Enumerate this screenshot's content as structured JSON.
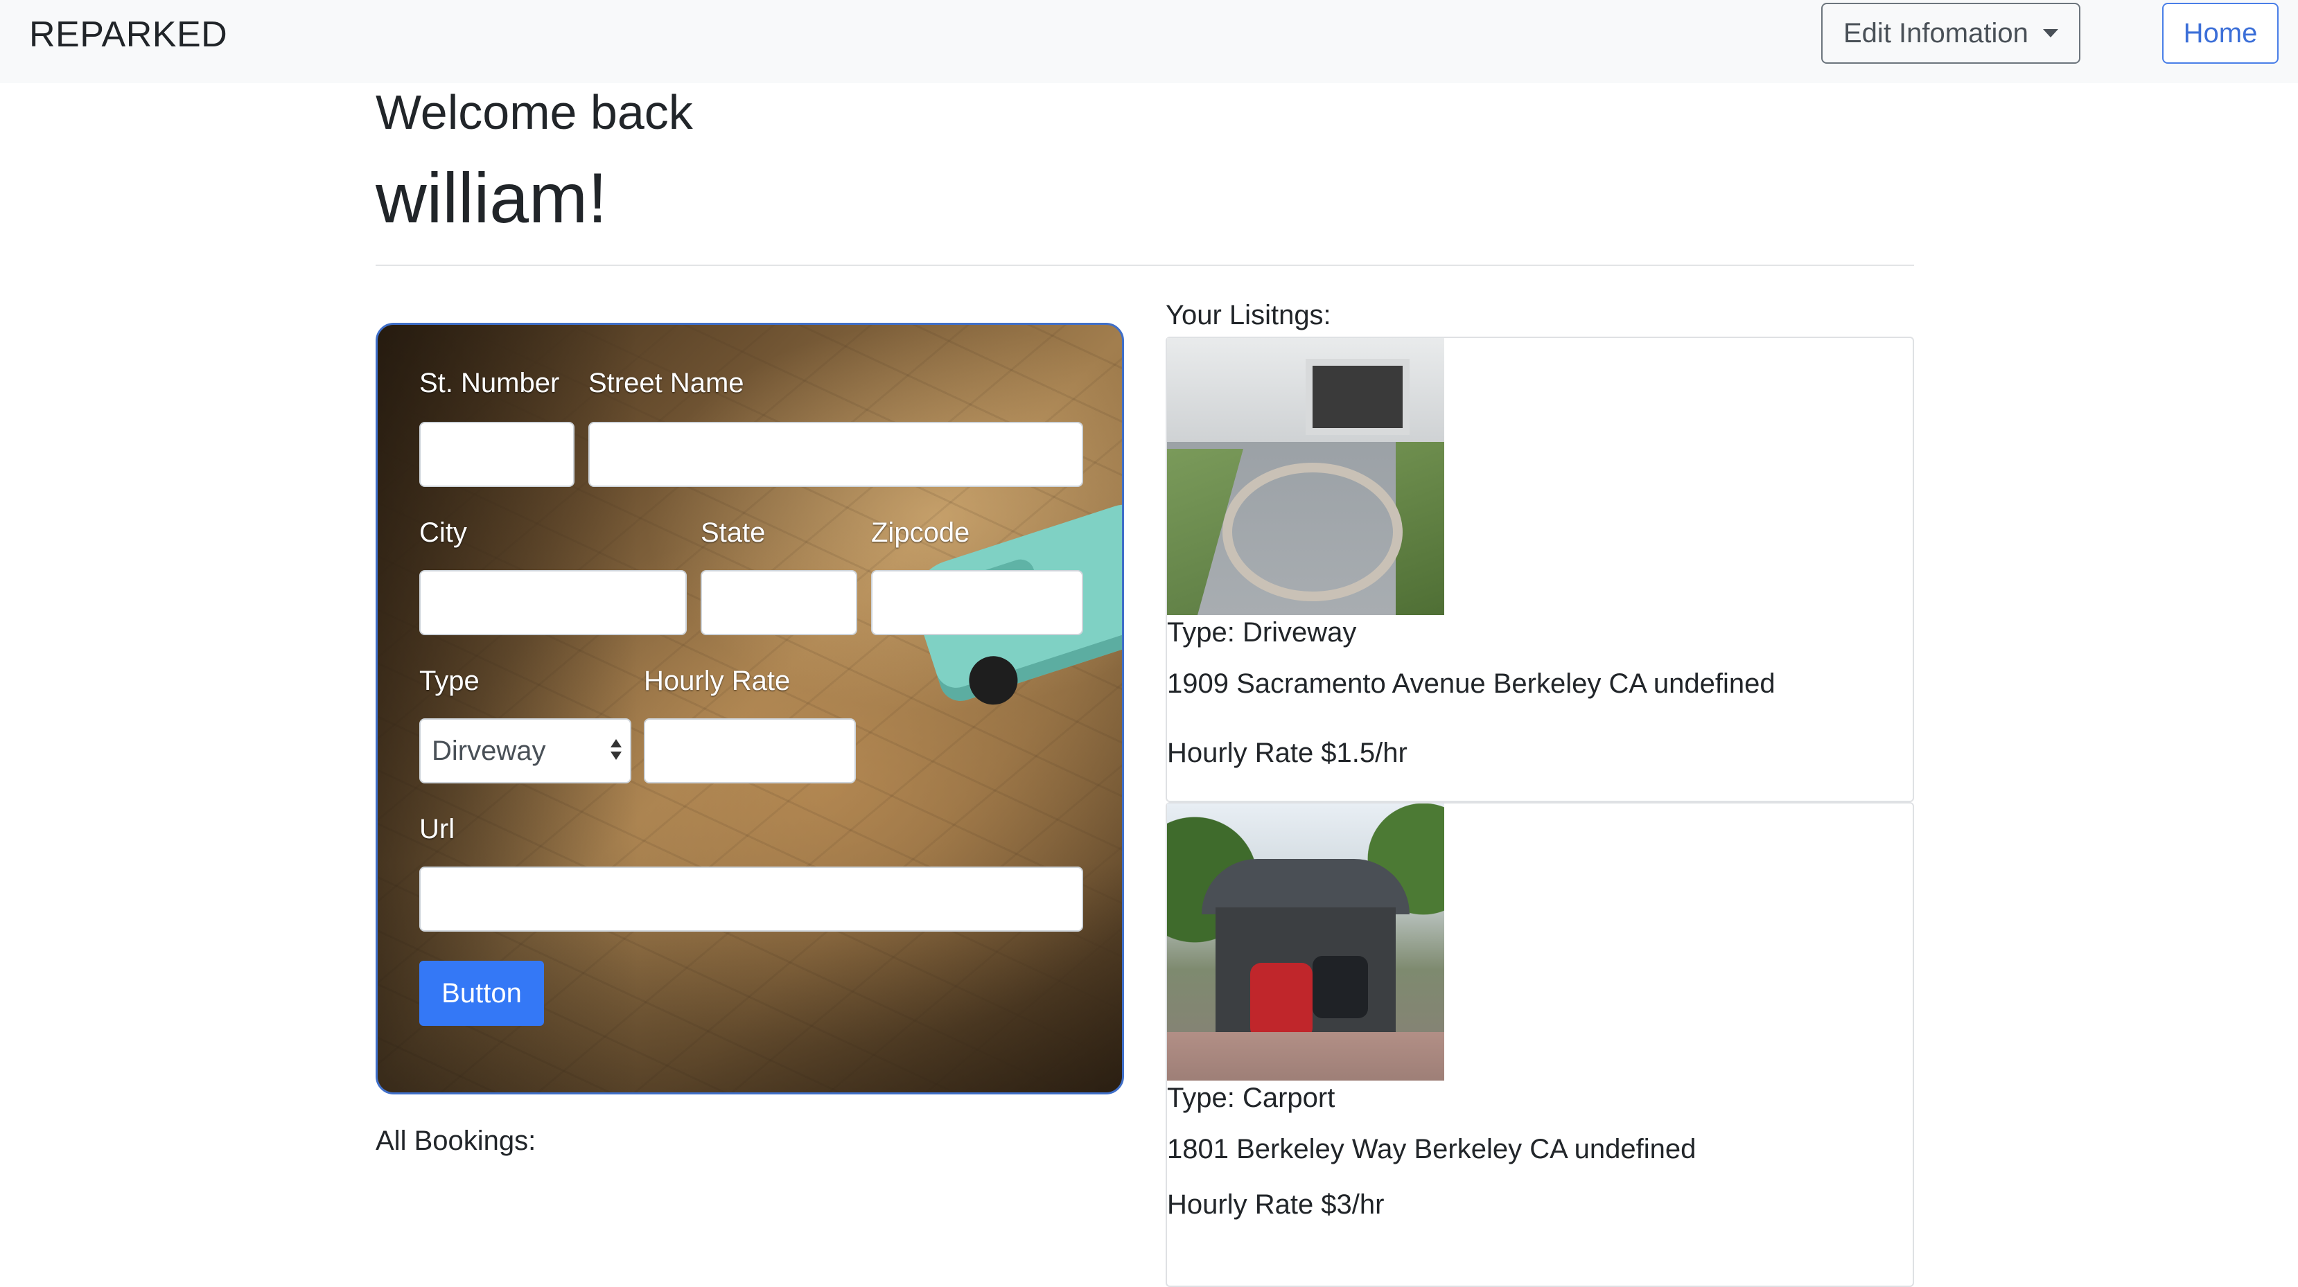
{
  "navbar": {
    "brand": "REPARKED",
    "edit_label": "Edit Infomation",
    "home_label": "Home"
  },
  "header": {
    "welcome": "Welcome back",
    "username": "william!"
  },
  "form": {
    "labels": {
      "st_number": "St. Number",
      "street_name": "Street Name",
      "city": "City",
      "state": "State",
      "zipcode": "Zipcode",
      "type": "Type",
      "hourly_rate": "Hourly Rate",
      "url": "Url"
    },
    "type_selected": "Dirveway",
    "submit_label": "Button"
  },
  "bookings": {
    "label": "All Bookings:"
  },
  "listings": {
    "title": "Your Lisitngs:",
    "items": [
      {
        "type": "Type: Driveway",
        "address": "1909 Sacramento Avenue Berkeley CA undefined",
        "rate": "Hourly Rate $1.5/hr"
      },
      {
        "type": "Type: Carport",
        "address": "1801 Berkeley Way Berkeley CA undefined",
        "rate": "Hourly Rate $3/hr"
      }
    ]
  },
  "colors": {
    "accent": "#3478f6",
    "card_border": "#3f6fc9",
    "navbar_bg": "#f8f9fa"
  }
}
